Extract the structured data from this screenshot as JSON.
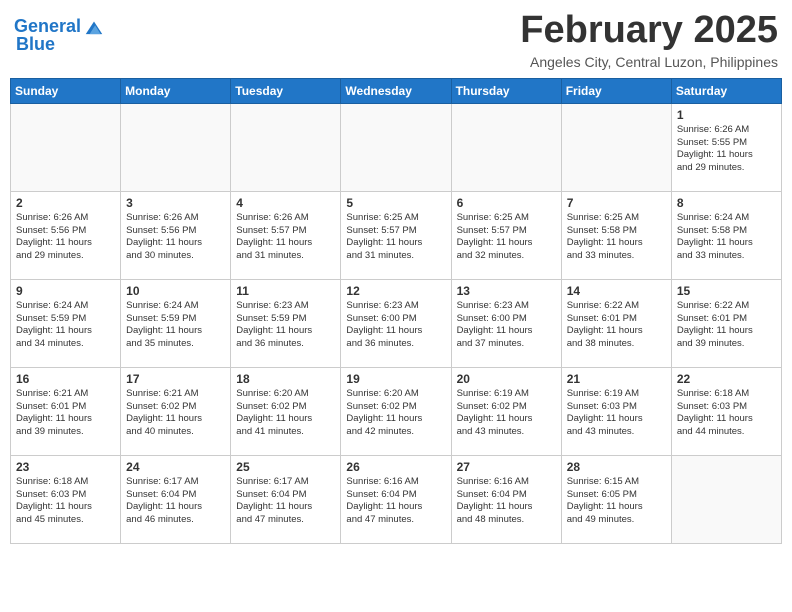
{
  "header": {
    "logo_line1": "General",
    "logo_line2": "Blue",
    "month": "February 2025",
    "location": "Angeles City, Central Luzon, Philippines"
  },
  "days_of_week": [
    "Sunday",
    "Monday",
    "Tuesday",
    "Wednesday",
    "Thursday",
    "Friday",
    "Saturday"
  ],
  "weeks": [
    [
      {
        "day": "",
        "info": ""
      },
      {
        "day": "",
        "info": ""
      },
      {
        "day": "",
        "info": ""
      },
      {
        "day": "",
        "info": ""
      },
      {
        "day": "",
        "info": ""
      },
      {
        "day": "",
        "info": ""
      },
      {
        "day": "1",
        "info": "Sunrise: 6:26 AM\nSunset: 5:55 PM\nDaylight: 11 hours\nand 29 minutes."
      }
    ],
    [
      {
        "day": "2",
        "info": "Sunrise: 6:26 AM\nSunset: 5:56 PM\nDaylight: 11 hours\nand 29 minutes."
      },
      {
        "day": "3",
        "info": "Sunrise: 6:26 AM\nSunset: 5:56 PM\nDaylight: 11 hours\nand 30 minutes."
      },
      {
        "day": "4",
        "info": "Sunrise: 6:26 AM\nSunset: 5:57 PM\nDaylight: 11 hours\nand 31 minutes."
      },
      {
        "day": "5",
        "info": "Sunrise: 6:25 AM\nSunset: 5:57 PM\nDaylight: 11 hours\nand 31 minutes."
      },
      {
        "day": "6",
        "info": "Sunrise: 6:25 AM\nSunset: 5:57 PM\nDaylight: 11 hours\nand 32 minutes."
      },
      {
        "day": "7",
        "info": "Sunrise: 6:25 AM\nSunset: 5:58 PM\nDaylight: 11 hours\nand 33 minutes."
      },
      {
        "day": "8",
        "info": "Sunrise: 6:24 AM\nSunset: 5:58 PM\nDaylight: 11 hours\nand 33 minutes."
      }
    ],
    [
      {
        "day": "9",
        "info": "Sunrise: 6:24 AM\nSunset: 5:59 PM\nDaylight: 11 hours\nand 34 minutes."
      },
      {
        "day": "10",
        "info": "Sunrise: 6:24 AM\nSunset: 5:59 PM\nDaylight: 11 hours\nand 35 minutes."
      },
      {
        "day": "11",
        "info": "Sunrise: 6:23 AM\nSunset: 5:59 PM\nDaylight: 11 hours\nand 36 minutes."
      },
      {
        "day": "12",
        "info": "Sunrise: 6:23 AM\nSunset: 6:00 PM\nDaylight: 11 hours\nand 36 minutes."
      },
      {
        "day": "13",
        "info": "Sunrise: 6:23 AM\nSunset: 6:00 PM\nDaylight: 11 hours\nand 37 minutes."
      },
      {
        "day": "14",
        "info": "Sunrise: 6:22 AM\nSunset: 6:01 PM\nDaylight: 11 hours\nand 38 minutes."
      },
      {
        "day": "15",
        "info": "Sunrise: 6:22 AM\nSunset: 6:01 PM\nDaylight: 11 hours\nand 39 minutes."
      }
    ],
    [
      {
        "day": "16",
        "info": "Sunrise: 6:21 AM\nSunset: 6:01 PM\nDaylight: 11 hours\nand 39 minutes."
      },
      {
        "day": "17",
        "info": "Sunrise: 6:21 AM\nSunset: 6:02 PM\nDaylight: 11 hours\nand 40 minutes."
      },
      {
        "day": "18",
        "info": "Sunrise: 6:20 AM\nSunset: 6:02 PM\nDaylight: 11 hours\nand 41 minutes."
      },
      {
        "day": "19",
        "info": "Sunrise: 6:20 AM\nSunset: 6:02 PM\nDaylight: 11 hours\nand 42 minutes."
      },
      {
        "day": "20",
        "info": "Sunrise: 6:19 AM\nSunset: 6:02 PM\nDaylight: 11 hours\nand 43 minutes."
      },
      {
        "day": "21",
        "info": "Sunrise: 6:19 AM\nSunset: 6:03 PM\nDaylight: 11 hours\nand 43 minutes."
      },
      {
        "day": "22",
        "info": "Sunrise: 6:18 AM\nSunset: 6:03 PM\nDaylight: 11 hours\nand 44 minutes."
      }
    ],
    [
      {
        "day": "23",
        "info": "Sunrise: 6:18 AM\nSunset: 6:03 PM\nDaylight: 11 hours\nand 45 minutes."
      },
      {
        "day": "24",
        "info": "Sunrise: 6:17 AM\nSunset: 6:04 PM\nDaylight: 11 hours\nand 46 minutes."
      },
      {
        "day": "25",
        "info": "Sunrise: 6:17 AM\nSunset: 6:04 PM\nDaylight: 11 hours\nand 47 minutes."
      },
      {
        "day": "26",
        "info": "Sunrise: 6:16 AM\nSunset: 6:04 PM\nDaylight: 11 hours\nand 47 minutes."
      },
      {
        "day": "27",
        "info": "Sunrise: 6:16 AM\nSunset: 6:04 PM\nDaylight: 11 hours\nand 48 minutes."
      },
      {
        "day": "28",
        "info": "Sunrise: 6:15 AM\nSunset: 6:05 PM\nDaylight: 11 hours\nand 49 minutes."
      },
      {
        "day": "",
        "info": ""
      }
    ]
  ]
}
